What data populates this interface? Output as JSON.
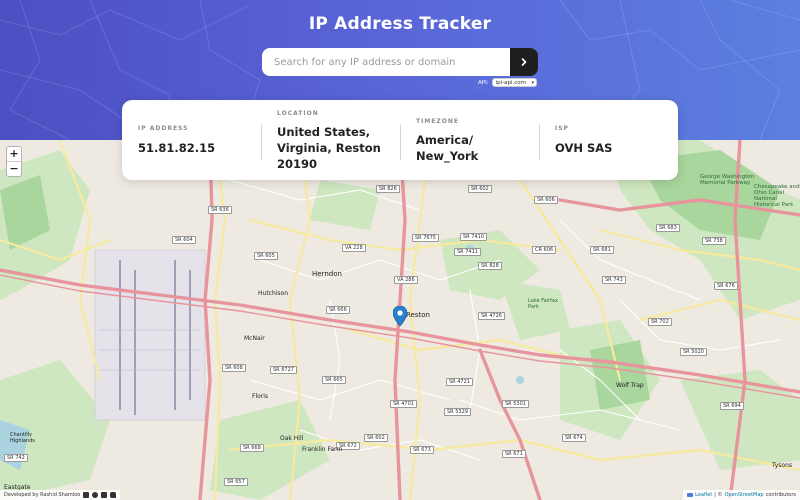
{
  "header": {
    "title": "IP Address Tracker",
    "search_placeholder": "Search for any IP address or domain",
    "api_label": "API:",
    "api_selected": "ipi-api.com"
  },
  "info": [
    {
      "label": "IP ADDRESS",
      "value": "51.81.82.15"
    },
    {
      "label": "LOCATION",
      "value": "United States, Virginia, Reston 20190"
    },
    {
      "label": "TIMEZONE",
      "value": "America/ New_York"
    },
    {
      "label": "ISP",
      "value": "OVH SAS"
    }
  ],
  "map": {
    "zoom_in": "+",
    "zoom_out": "−",
    "road_labels": [
      "SR 826",
      "SR 602",
      "SR 636",
      "VA 228",
      "SR 7675",
      "SR 7410",
      "SR 604",
      "SR 606",
      "SR 828",
      "SR 605",
      "SR 4726",
      "SR 666",
      "SR 608",
      "SR 8727",
      "SR 665",
      "SR 4701",
      "SR 5329",
      "SR 5301",
      "SR 672",
      "SR 668",
      "SR 673",
      "SR 602",
      "SR 674",
      "SR 657",
      "SR 671",
      "SR 681",
      "SR 683",
      "SR 738",
      "SR 743",
      "SR 702",
      "SR 5020",
      "SR 676",
      "SR 4721",
      "SR 7411",
      "SR 694",
      "SR 742",
      "VA 286",
      "CR 606"
    ],
    "place_labels": [
      "Herndon",
      "Reston",
      "Hutchison",
      "McNair",
      "Floris",
      "Oak Hill",
      "Franklin Farm",
      "Eastgate",
      "Wolf Trap",
      "Tysons",
      "Chesapeake and Ohio Canal National Historical Park",
      "George Washington Memorial Parkway",
      "Lake Fairfax Park",
      "Chantilly Highlands"
    ]
  },
  "footer": {
    "developer_text": "Developed by Rashid Shamloo"
  },
  "attribution": {
    "leaflet": "Leaflet",
    "separator": "| ©",
    "osm": "OpenStreetMap",
    "contributors": "contributors"
  }
}
